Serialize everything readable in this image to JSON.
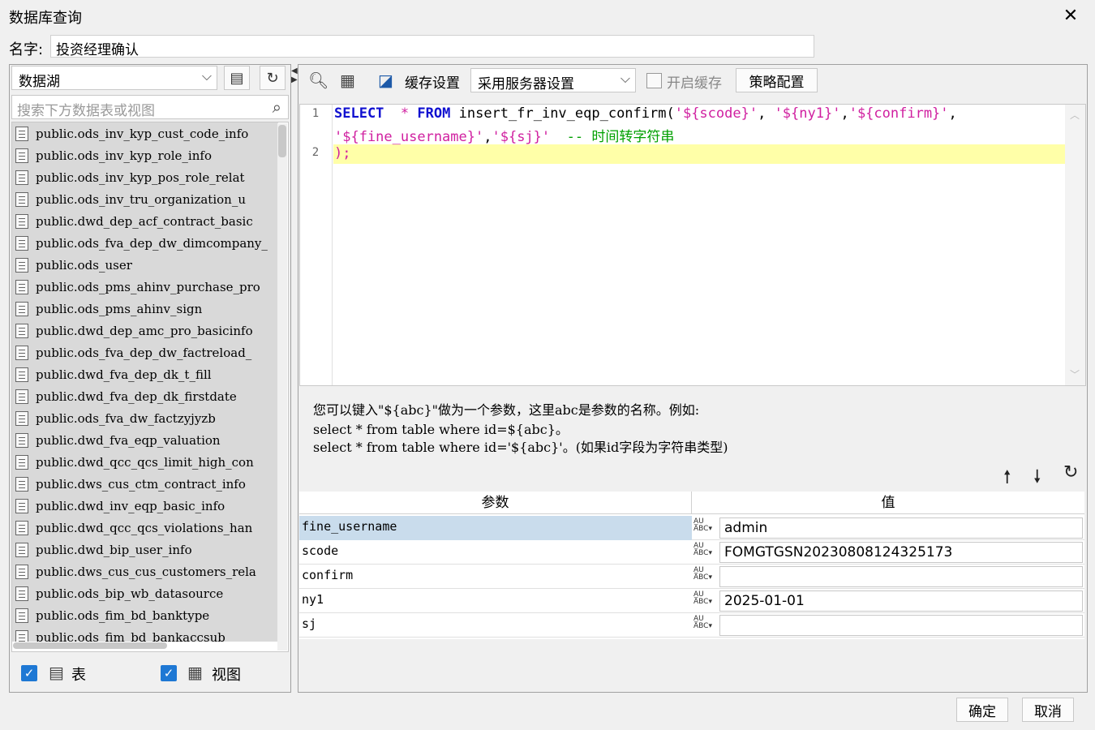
{
  "window": {
    "title": "数据库查询"
  },
  "name": {
    "label": "名字:",
    "value": "投资经理确认"
  },
  "left": {
    "datasource": "数据湖",
    "search_placeholder": "搜索下方数据表或视图",
    "tables": [
      "public.ods_inv_kyp_cust_code_info",
      "public.ods_inv_kyp_role_info",
      "public.ods_inv_kyp_pos_role_relat",
      "public.ods_inv_tru_organization_u",
      "public.dwd_dep_acf_contract_basic",
      "public.ods_fva_dep_dw_dimcompany_",
      "public.ods_user",
      "public.ods_pms_ahinv_purchase_pro",
      "public.ods_pms_ahinv_sign",
      "public.dwd_dep_amc_pro_basicinfo",
      "public.ods_fva_dep_dw_factreload_",
      "public.dwd_fva_dep_dk_t_fill",
      "public.dwd_fva_dep_dk_firstdate",
      "public.ods_fva_dw_factzyjyzb",
      "public.dwd_fva_eqp_valuation",
      "public.dwd_qcc_qcs_limit_high_con",
      "public.dws_cus_ctm_contract_info",
      "public.dwd_inv_eqp_basic_info",
      "public.dwd_qcc_qcs_violations_han",
      "public.dwd_bip_user_info",
      "public.dws_cus_cus_customers_rela",
      "public.ods_bip_wb_datasource",
      "public.ods_fim_bd_banktype",
      "public.ods_fim_bd_bankaccsub"
    ],
    "check_table": "表",
    "check_view": "视图"
  },
  "toolbar": {
    "cache_settings": "缓存设置",
    "cache_option": "采用服务器设置",
    "enable_cache": "开启缓存",
    "strategy": "策略配置"
  },
  "editor": {
    "line1_num": "1",
    "line2_num": "2",
    "kw_select": "SELECT",
    "star": "*",
    "kw_from": "FROM",
    "func": "insert_fr_inv_eqp_confirm(",
    "s1": "'${scode}'",
    "sep1": ", ",
    "s2": "'${ny1}'",
    "sep2": ",",
    "s3": "'${confirm}'",
    "sep3": ",",
    "s4": "'${fine_username}'",
    "sep4": ",",
    "s5": "'${sj}'",
    "comment": "-- 时间转字符串",
    "line2": ");"
  },
  "hint": {
    "line1": "您可以键入\"${abc}\"做为一个参数，这里abc是参数的名称。例如:",
    "line2": "select * from table where id=${abc}。",
    "line3": "select * from table where id='${abc}'。(如果id字段为字符串类型)"
  },
  "params": {
    "col_name": "参数",
    "col_value": "值",
    "rows": [
      {
        "name": "fine_username",
        "value": "admin"
      },
      {
        "name": "scode",
        "value": "FOMGTGSN20230808124325173"
      },
      {
        "name": "confirm",
        "value": ""
      },
      {
        "name": "ny1",
        "value": "2025-01-01"
      },
      {
        "name": "sj",
        "value": ""
      }
    ]
  },
  "footer": {
    "ok": "确定",
    "cancel": "取消"
  }
}
